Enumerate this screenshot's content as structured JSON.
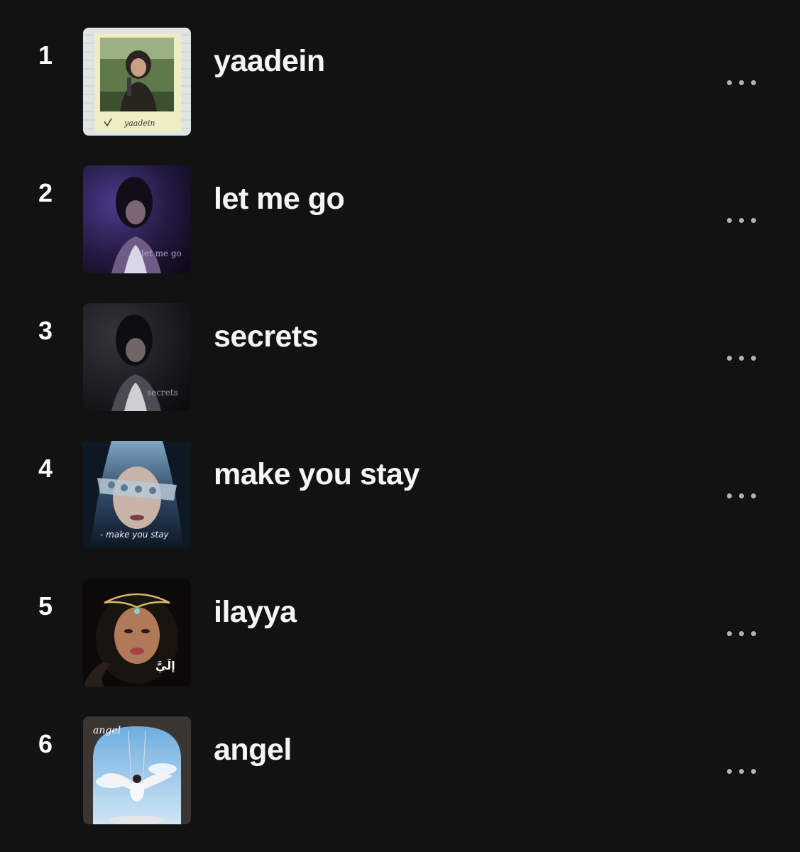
{
  "tracks": [
    {
      "number": "1",
      "title": "yaadein",
      "cover_caption": "yaadein"
    },
    {
      "number": "2",
      "title": "let me go",
      "cover_caption": "let me go"
    },
    {
      "number": "3",
      "title": "secrets",
      "cover_caption": "secrets"
    },
    {
      "number": "4",
      "title": "make you stay",
      "cover_caption": "- make you stay"
    },
    {
      "number": "5",
      "title": "ilayya",
      "cover_caption": "إلَيَّ"
    },
    {
      "number": "6",
      "title": "angel",
      "cover_caption": "angel"
    }
  ],
  "more_icon": "ellipsis-horizontal-icon",
  "colors": {
    "background": "#121212",
    "text": "#ffffff",
    "icon": "#b3b3b3"
  }
}
